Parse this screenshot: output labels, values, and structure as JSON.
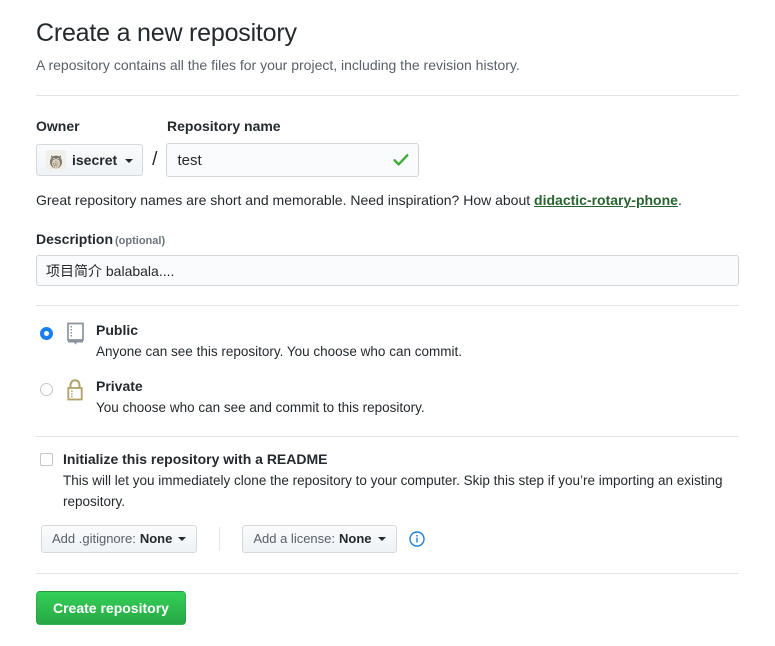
{
  "header": {
    "title": "Create a new repository",
    "subtitle": "A repository contains all the files for your project, including the revision history."
  },
  "name_section": {
    "owner_label": "Owner",
    "repo_name_label": "Repository name",
    "owner_value": "isecret",
    "separator": "/",
    "repo_name_value": "test",
    "repo_name_placeholder": "",
    "valid_icon": "check-icon",
    "avatar_icon": "totoro-avatar",
    "hint_prefix": "Great repository names are short and memorable. Need inspiration? How about ",
    "hint_suggestion": "didactic-rotary-phone",
    "hint_suffix": "."
  },
  "description": {
    "label": "Description",
    "optional_label": "(optional)",
    "value": "项目简介 balabala....",
    "placeholder": ""
  },
  "visibility": {
    "options": [
      {
        "id": "public",
        "title": "Public",
        "description": "Anyone can see this repository. You choose who can commit.",
        "icon": "repo-book-icon",
        "selected": true
      },
      {
        "id": "private",
        "title": "Private",
        "description": "You choose who can see and commit to this repository.",
        "icon": "lock-icon",
        "selected": false
      }
    ]
  },
  "readme": {
    "checkbox_label": "Initialize this repository with a README",
    "checkbox_checked": false,
    "description": "This will let you immediately clone the repository to your computer. Skip this step if you’re importing an existing repository.",
    "gitignore_prefix": "Add .gitignore:",
    "gitignore_value": "None",
    "license_prefix": "Add a license:",
    "license_value": "None",
    "info_icon": "info-icon"
  },
  "submit": {
    "label": "Create repository"
  },
  "colors": {
    "accent_green": "#28a745",
    "suggestion_green": "#28632f",
    "radio_blue": "#1a7ff1",
    "info_blue": "#0366d6",
    "lock_tan": "#b0a06a",
    "repo_grey": "#8b949e",
    "divider": "#e1e4e8",
    "text": "#24292e",
    "muted_text": "#586069"
  }
}
